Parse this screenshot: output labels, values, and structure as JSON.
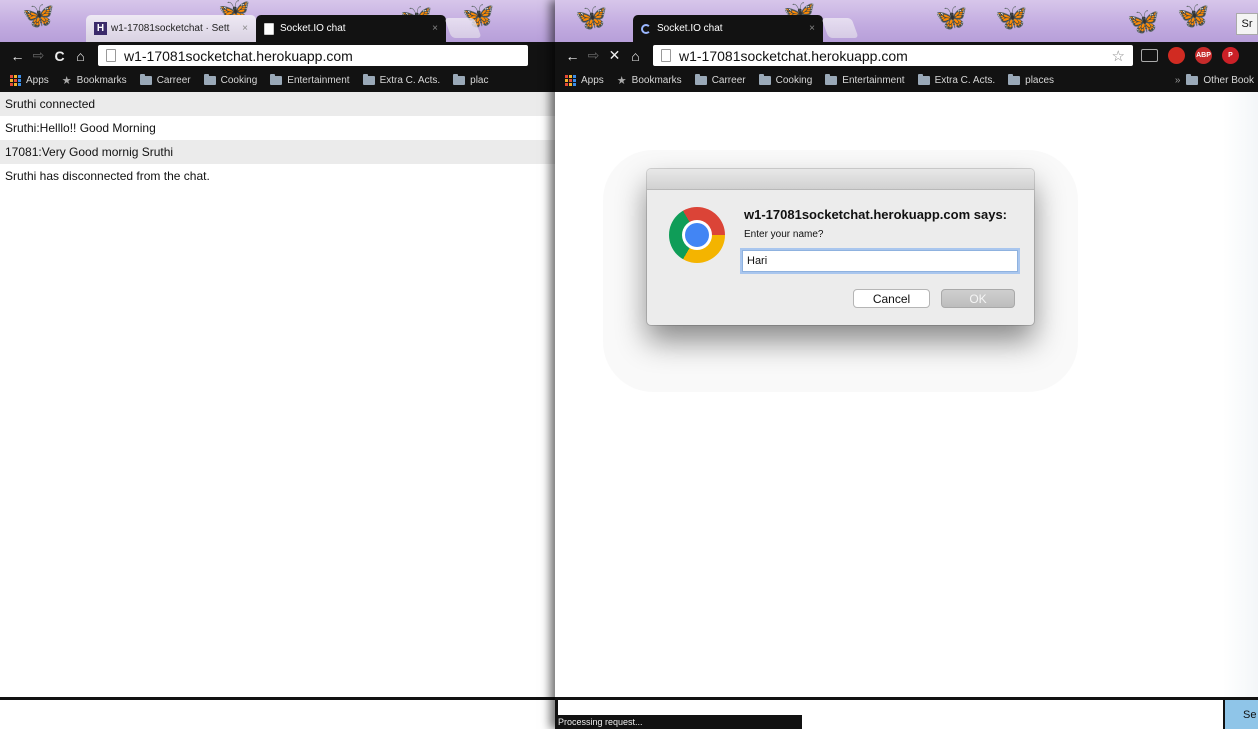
{
  "left_window": {
    "tabs": [
      {
        "title": "w1-17081socketchat · Sett",
        "active": false
      },
      {
        "title": "Socket.IO chat",
        "active": true
      }
    ],
    "url": "w1-17081socketchat.herokuapp.com",
    "bookmarks": [
      "Apps",
      "Bookmarks",
      "Carreer",
      "Cooking",
      "Entertainment",
      "Extra C. Acts.",
      "plac"
    ],
    "messages": [
      "Sruthi connected",
      "Sruthi:Helllo!! Good Morning",
      "17081:Very Good mornig Sruthi",
      "Sruthi has disconnected from the chat."
    ]
  },
  "right_window": {
    "tabs": [
      {
        "title": "Socket.IO chat",
        "active": true
      }
    ],
    "profile_label": "Sr",
    "url": "w1-17081socketchat.herokuapp.com",
    "bookmarks": [
      "Apps",
      "Bookmarks",
      "Carreer",
      "Cooking",
      "Entertainment",
      "Extra C. Acts.",
      "places"
    ],
    "bookmarks_overflow": "»",
    "other_bookmarks": "Other Book",
    "extensions": [
      "cast-icon",
      "stop-icon",
      "adblock-plus-icon",
      "pinterest-icon"
    ],
    "send_label": "Se",
    "status_text": "Processing request..."
  },
  "dialog": {
    "heading": "w1-17081socketchat.herokuapp.com says:",
    "prompt": "Enter your name?",
    "input_value": "Hari",
    "cancel_label": "Cancel",
    "ok_label": "OK"
  },
  "icons": {
    "back": "←",
    "forward": "⇨",
    "reload": "C",
    "stop": "✕",
    "home": "⌂",
    "star": "☆",
    "tab_close": "×",
    "bookmark_star": "★"
  }
}
